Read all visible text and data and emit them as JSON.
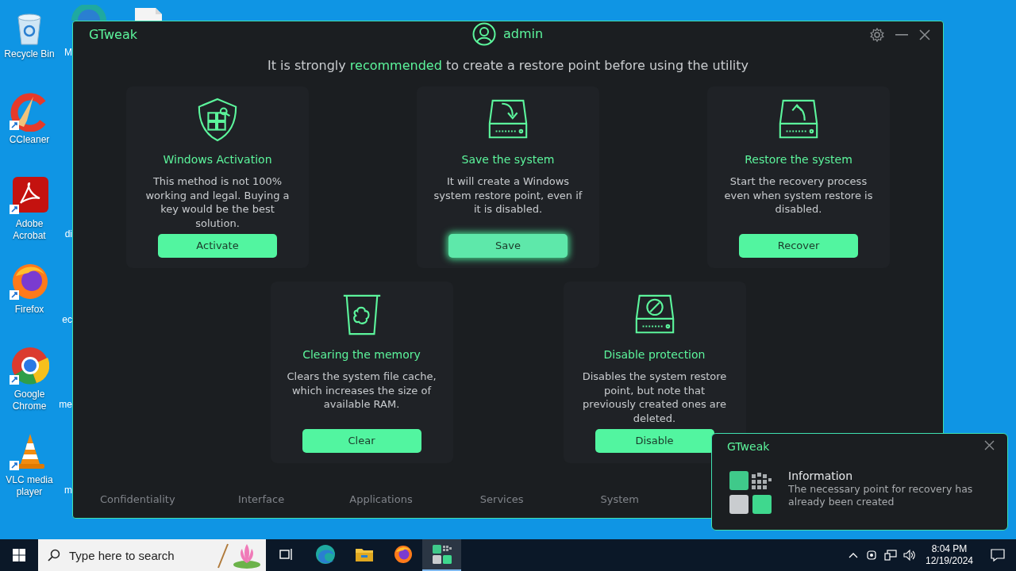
{
  "desktop_icons": [
    {
      "label": "Recycle Bin",
      "kind": "recycle",
      "neighbor_label": "M"
    },
    {
      "label": "CCleaner",
      "kind": "ccleaner"
    },
    {
      "label": "Adobe Acrobat",
      "kind": "acrobat",
      "neighbor_label": "di"
    },
    {
      "label": "Firefox",
      "kind": "firefox",
      "neighbor_label": "ec"
    },
    {
      "label": "Google Chrome",
      "kind": "chrome",
      "neighbor_label": "me"
    },
    {
      "label": "VLC media player",
      "kind": "vlc",
      "neighbor_label": "m"
    }
  ],
  "window": {
    "title": "GTweak",
    "user": "admin",
    "notice": "It is strongly **recommended** to create a restore point before using the utility",
    "cards": [
      {
        "kind": "shield",
        "title": "Windows Activation",
        "description": "This method is not 100% working and legal. Buying a key would be the best solution.",
        "button": "Activate",
        "hovered": false
      },
      {
        "kind": "drive-down",
        "title": "Save the system",
        "description": "It will create a Windows system restore point, even if it is disabled.",
        "button": "Save",
        "hovered": true
      },
      {
        "kind": "drive-up",
        "title": "Restore the system",
        "description": "Start the recovery process even when system restore is disabled.",
        "button": "Recover",
        "hovered": false
      },
      {
        "kind": "trash",
        "title": "Clearing the memory",
        "description": "Clears the system file cache, which increases the size of available RAM.",
        "button": "Clear",
        "hovered": false
      },
      {
        "kind": "drive-off",
        "title": "Disable protection",
        "description": "Disables the system restore point, but note that previously created ones are deleted.",
        "button": "Disable",
        "hovered": false
      }
    ],
    "nav": [
      {
        "label": "Confidentiality"
      },
      {
        "label": "Interface"
      },
      {
        "label": "Applications"
      },
      {
        "label": "Services"
      },
      {
        "label": "System"
      }
    ]
  },
  "notification": {
    "app": "GTweak",
    "title": "Information",
    "message": "The necessary point for recovery has already been created"
  },
  "taskbar": {
    "search_placeholder": "Type here to search",
    "apps": [
      {
        "kind": "taskview",
        "active": false
      },
      {
        "kind": "edge",
        "active": false
      },
      {
        "kind": "explorer",
        "active": false
      },
      {
        "kind": "firefox",
        "active": false
      },
      {
        "kind": "gtweak",
        "active": true
      }
    ],
    "time": "8:04 PM",
    "date": "12/19/2024"
  }
}
